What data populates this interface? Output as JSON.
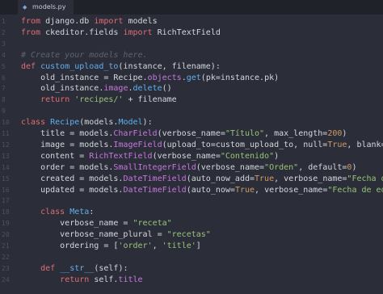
{
  "tab": {
    "filename": "models.py",
    "icon": "python-file-icon"
  },
  "colors": {
    "background": "#2b2e38",
    "keyword": "#e06c75",
    "function": "#61afef",
    "string": "#98c379",
    "comment": "#5c6370"
  },
  "lines": [
    {
      "n": "1",
      "parts": [
        [
          "kw",
          "from"
        ],
        [
          "pl",
          " django.db "
        ],
        [
          "kw",
          "import"
        ],
        [
          "pl",
          " models"
        ]
      ]
    },
    {
      "n": "2",
      "parts": [
        [
          "kw",
          "from"
        ],
        [
          "pl",
          " ckeditor.fields "
        ],
        [
          "kw",
          "import"
        ],
        [
          "pl",
          " RichTextField"
        ]
      ]
    },
    {
      "n": "3",
      "parts": []
    },
    {
      "n": "4",
      "parts": [
        [
          "cm",
          "# Create your models here."
        ]
      ]
    },
    {
      "n": "5",
      "parts": [
        [
          "kw",
          "def"
        ],
        [
          "pl",
          " "
        ],
        [
          "fn",
          "custom_upload_to"
        ],
        [
          "pl",
          "(instance, filename):"
        ]
      ]
    },
    {
      "n": "6",
      "parts": [
        [
          "pl",
          "    old_instance = Recipe."
        ],
        [
          "call",
          "objects"
        ],
        [
          "pl",
          "."
        ],
        [
          "fn",
          "get"
        ],
        [
          "pl",
          "(pk=instance.pk)"
        ]
      ]
    },
    {
      "n": "7",
      "parts": [
        [
          "pl",
          "    old_instance."
        ],
        [
          "call",
          "image"
        ],
        [
          "pl",
          "."
        ],
        [
          "fn",
          "delete"
        ],
        [
          "pl",
          "()"
        ]
      ]
    },
    {
      "n": "8",
      "parts": [
        [
          "pl",
          "    "
        ],
        [
          "kw",
          "return"
        ],
        [
          "pl",
          " "
        ],
        [
          "str",
          "'recipes/'"
        ],
        [
          "pl",
          " + filename"
        ]
      ]
    },
    {
      "n": "9",
      "parts": []
    },
    {
      "n": "10",
      "parts": [
        [
          "kw",
          "class"
        ],
        [
          "pl",
          " "
        ],
        [
          "cls",
          "Recipe"
        ],
        [
          "pl",
          "(models."
        ],
        [
          "fn",
          "Model"
        ],
        [
          "pl",
          "):"
        ]
      ]
    },
    {
      "n": "11",
      "parts": [
        [
          "pl",
          "    title = models."
        ],
        [
          "call",
          "CharField"
        ],
        [
          "pl",
          "(verbose_name="
        ],
        [
          "str",
          "\"Título\""
        ],
        [
          "pl",
          ", max_length="
        ],
        [
          "const",
          "200"
        ],
        [
          "pl",
          ")"
        ]
      ]
    },
    {
      "n": "12",
      "parts": [
        [
          "pl",
          "    image = models."
        ],
        [
          "call",
          "ImageField"
        ],
        [
          "pl",
          "(upload_to=custom_upload_to, null="
        ],
        [
          "const",
          "True"
        ],
        [
          "pl",
          ", blank="
        ],
        [
          "const",
          "True"
        ],
        [
          "pl",
          ")"
        ]
      ]
    },
    {
      "n": "13",
      "parts": [
        [
          "pl",
          "    content = "
        ],
        [
          "call",
          "RichTextField"
        ],
        [
          "pl",
          "(verbose_name="
        ],
        [
          "str",
          "\"Contenido\""
        ],
        [
          "pl",
          ")"
        ]
      ]
    },
    {
      "n": "14",
      "parts": [
        [
          "pl",
          "    order = models."
        ],
        [
          "call",
          "SmallIntegerField"
        ],
        [
          "pl",
          "(verbose_name="
        ],
        [
          "str",
          "\"Orden\""
        ],
        [
          "pl",
          ", default="
        ],
        [
          "const",
          "0"
        ],
        [
          "pl",
          ")"
        ]
      ]
    },
    {
      "n": "15",
      "parts": [
        [
          "pl",
          "    created = models."
        ],
        [
          "call",
          "DateTimeField"
        ],
        [
          "pl",
          "(auto_now_add="
        ],
        [
          "const",
          "True"
        ],
        [
          "pl",
          ", verbose_name="
        ],
        [
          "str",
          "\"Fecha de creación\""
        ],
        [
          "pl",
          ")"
        ]
      ]
    },
    {
      "n": "16",
      "parts": [
        [
          "pl",
          "    updated = models."
        ],
        [
          "call",
          "DateTimeField"
        ],
        [
          "pl",
          "(auto_now="
        ],
        [
          "const",
          "True"
        ],
        [
          "pl",
          ", verbose_name="
        ],
        [
          "str",
          "\"Fecha de edición\""
        ],
        [
          "pl",
          ")"
        ]
      ]
    },
    {
      "n": "17",
      "parts": []
    },
    {
      "n": "18",
      "parts": [
        [
          "pl",
          "    "
        ],
        [
          "kw",
          "class"
        ],
        [
          "pl",
          " "
        ],
        [
          "cls",
          "Meta"
        ],
        [
          "pl",
          ":"
        ]
      ]
    },
    {
      "n": "19",
      "parts": [
        [
          "pl",
          "        verbose_name = "
        ],
        [
          "str",
          "\"receta\""
        ]
      ]
    },
    {
      "n": "20",
      "parts": [
        [
          "pl",
          "        verbose_name_plural = "
        ],
        [
          "str",
          "\"recetas\""
        ]
      ]
    },
    {
      "n": "21",
      "parts": [
        [
          "pl",
          "        ordering = ["
        ],
        [
          "str",
          "'order'"
        ],
        [
          "pl",
          ", "
        ],
        [
          "str",
          "'title'"
        ],
        [
          "pl",
          "]"
        ]
      ]
    },
    {
      "n": "22",
      "parts": []
    },
    {
      "n": "23",
      "parts": [
        [
          "pl",
          "    "
        ],
        [
          "kw",
          "def"
        ],
        [
          "pl",
          " "
        ],
        [
          "fn",
          "__str__"
        ],
        [
          "pl",
          "(self):"
        ]
      ]
    },
    {
      "n": "24",
      "parts": [
        [
          "pl",
          "        "
        ],
        [
          "kw",
          "return"
        ],
        [
          "pl",
          " self."
        ],
        [
          "call",
          "title"
        ]
      ]
    }
  ]
}
